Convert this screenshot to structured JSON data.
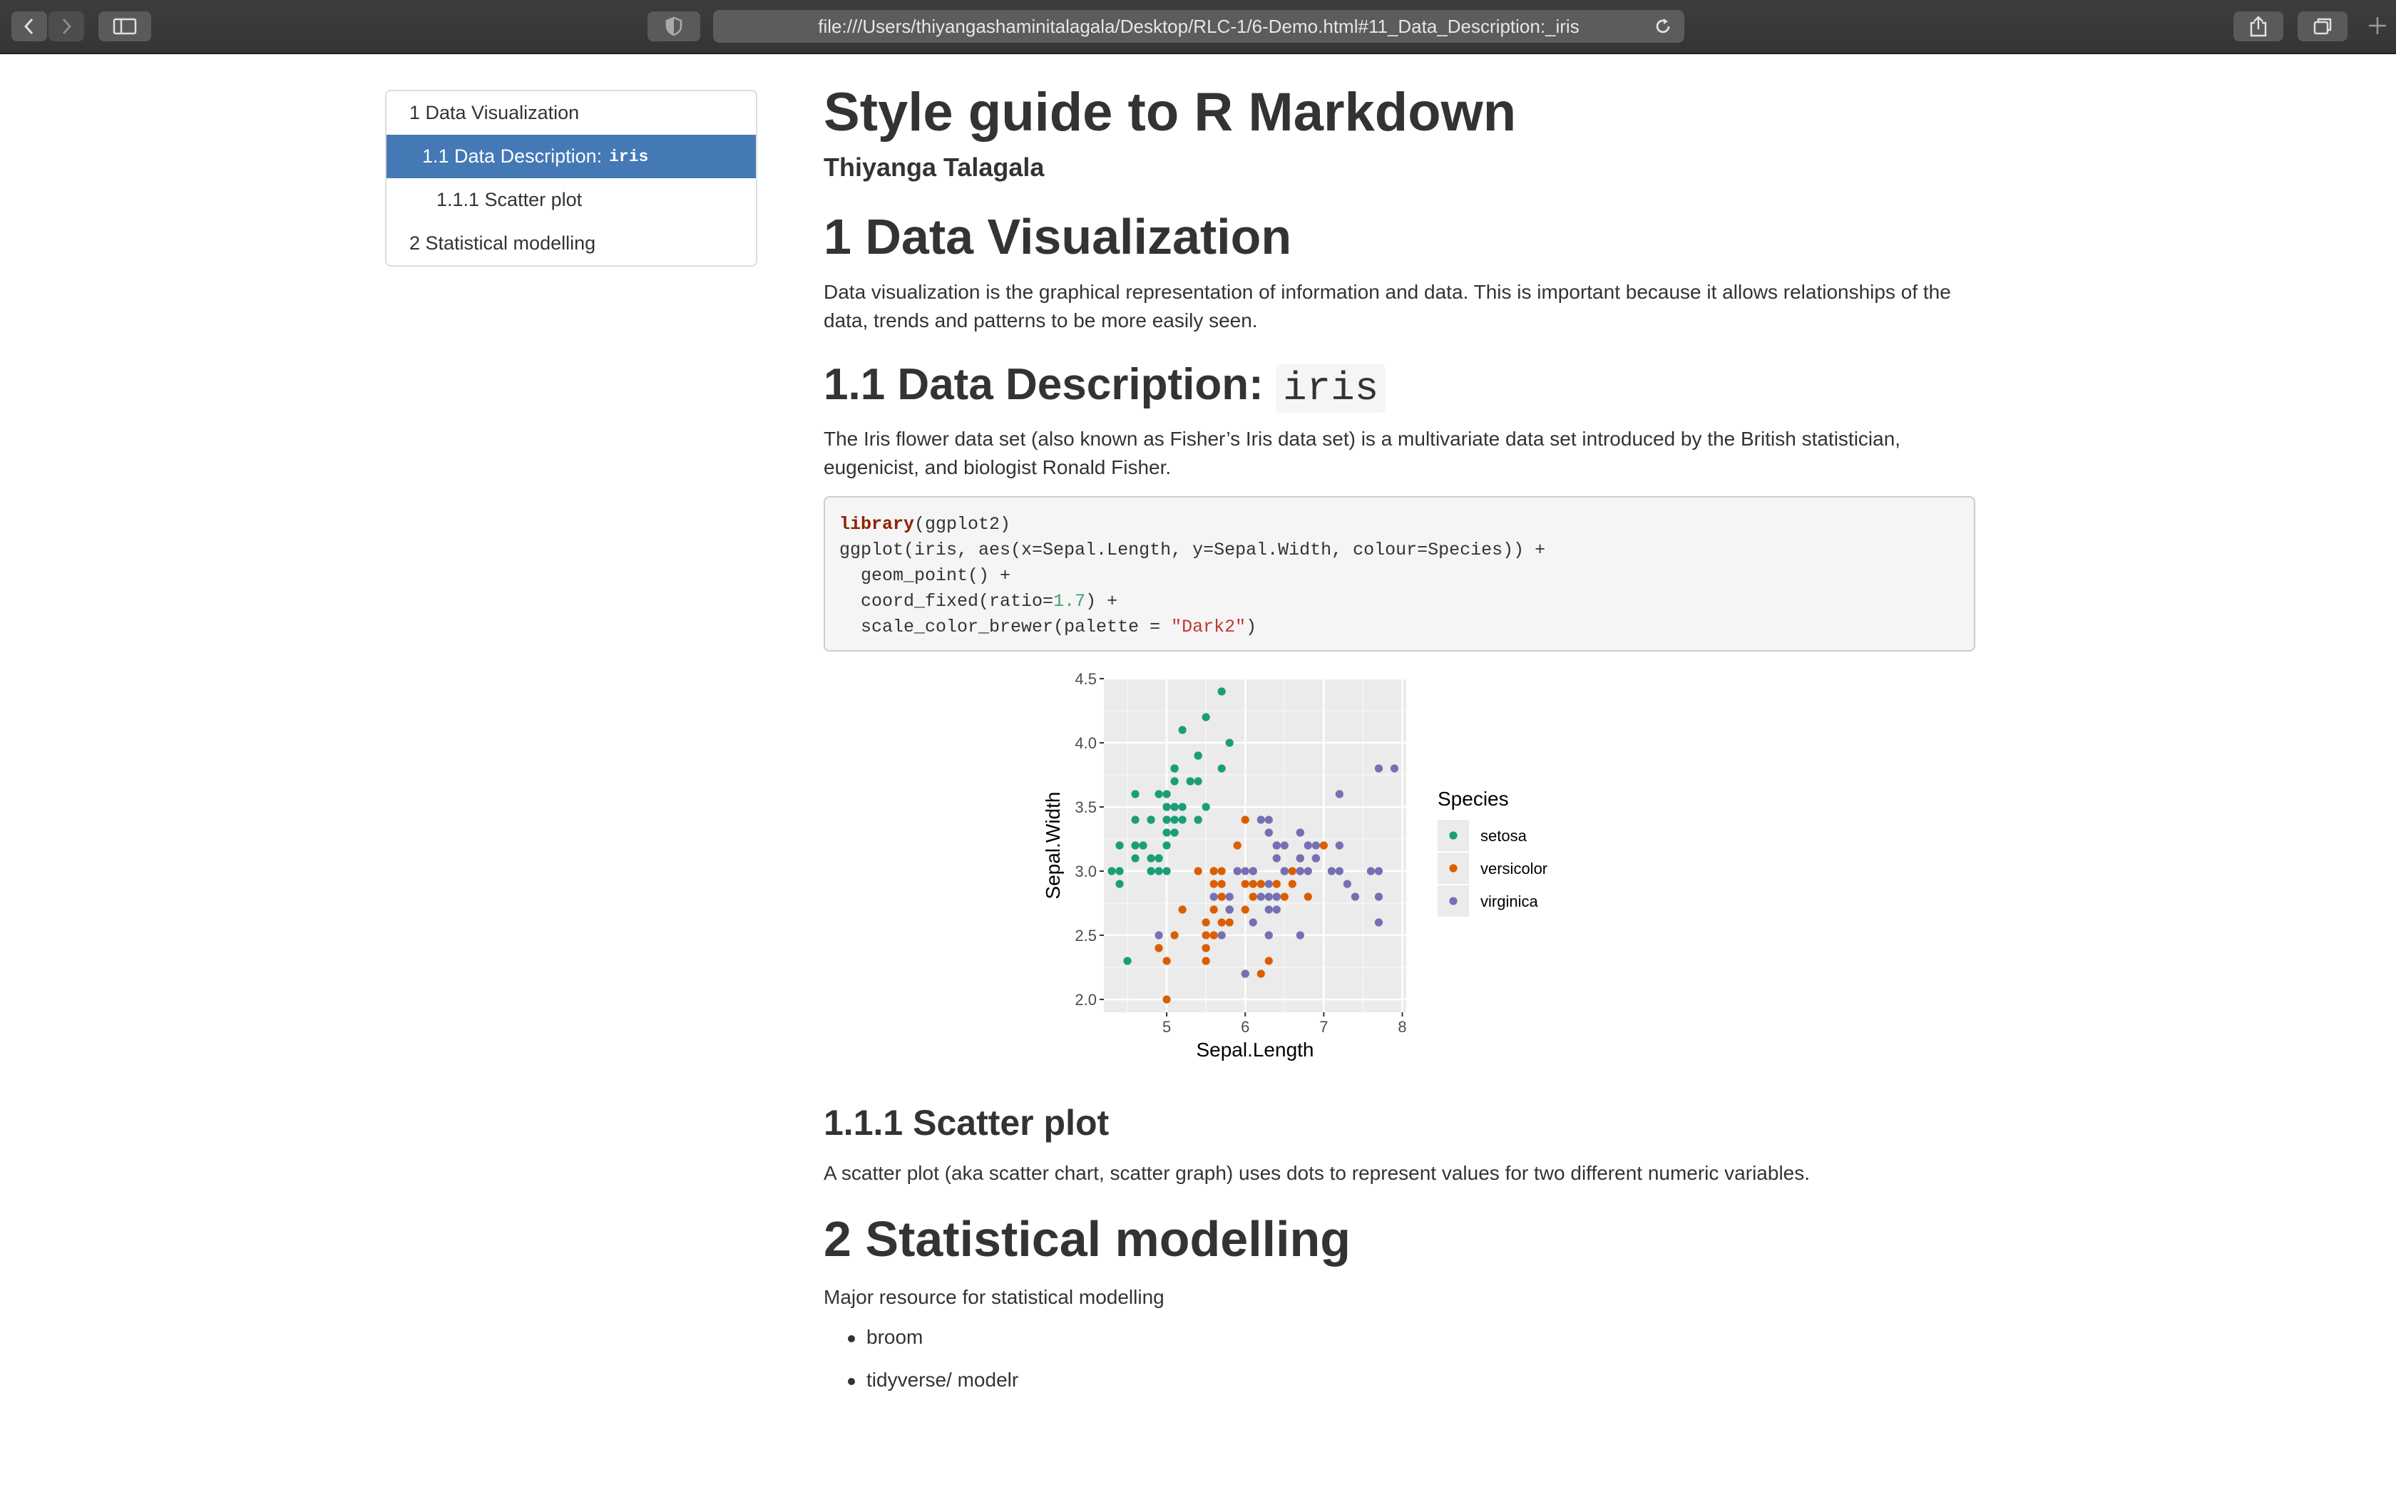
{
  "browser": {
    "url": "file:///Users/thiyangashaminitalagala/Desktop/RLC-1/6-Demo.html#11_Data_Description:_iris"
  },
  "toc": {
    "items": [
      {
        "label": "1 Data Visualization",
        "code": ""
      },
      {
        "label": "1.1 Data Description:",
        "code": "iris"
      },
      {
        "label": "1.1.1 Scatter plot",
        "code": ""
      },
      {
        "label": "2 Statistical modelling",
        "code": ""
      }
    ]
  },
  "doc": {
    "title": "Style guide to R Markdown",
    "author": "Thiyanga Talagala",
    "s1": {
      "heading": "1 Data Visualization",
      "text": "Data visualization is the graphical representation of information and data. This is important because it allows relationships of the data, trends and patterns to be more easily seen."
    },
    "s11": {
      "heading": "1.1 Data Description:",
      "code": "iris",
      "text": "The Iris flower data set (also known as Fisher’s Iris data set) is a multivariate data set introduced by the British statistician, eugenicist, and biologist Ronald Fisher."
    },
    "codeblock": {
      "l1_kw": "library",
      "l1_rest": "(ggplot2)",
      "l2": "ggplot(iris, aes(x=Sepal.Length, y=Sepal.Width, colour=Species)) +",
      "l3": "  geom_point() +",
      "l4_a": "  coord_fixed(ratio=",
      "l4_num": "1.7",
      "l4_b": ") +",
      "l5_a": "  scale_color_brewer(palette = ",
      "l5_str": "\"Dark2\"",
      "l5_b": ")"
    },
    "s111": {
      "heading": "1.1.1 Scatter plot",
      "text": "A scatter plot (aka scatter chart, scatter graph) uses dots to represent values for two different numeric variables."
    },
    "s2": {
      "heading": "2 Statistical modelling",
      "text": "Major resource for statistical modelling",
      "bullets": [
        "broom",
        "tidyverse/ modelr"
      ]
    }
  },
  "chart_data": {
    "type": "scatter",
    "xlabel": "Sepal.Length",
    "ylabel": "Sepal.Width",
    "xlim": [
      4.2,
      8.05
    ],
    "ylim": [
      1.9,
      4.5
    ],
    "xticks": [
      5,
      6,
      7,
      8
    ],
    "yticks": [
      "2.0",
      "2.5",
      "3.0",
      "3.5",
      "4.0",
      "4.5"
    ],
    "grid": true,
    "legend": {
      "title": "Species",
      "position": "right"
    },
    "series": [
      {
        "name": "setosa",
        "color": "#1b9e77",
        "points": [
          [
            5.1,
            3.5
          ],
          [
            4.9,
            3.0
          ],
          [
            4.7,
            3.2
          ],
          [
            4.6,
            3.1
          ],
          [
            5.0,
            3.6
          ],
          [
            5.4,
            3.9
          ],
          [
            4.6,
            3.4
          ],
          [
            5.0,
            3.4
          ],
          [
            4.4,
            2.9
          ],
          [
            4.9,
            3.1
          ],
          [
            5.4,
            3.7
          ],
          [
            4.8,
            3.4
          ],
          [
            4.8,
            3.0
          ],
          [
            4.3,
            3.0
          ],
          [
            5.8,
            4.0
          ],
          [
            5.7,
            4.4
          ],
          [
            5.4,
            3.9
          ],
          [
            5.1,
            3.5
          ],
          [
            5.7,
            3.8
          ],
          [
            5.1,
            3.8
          ],
          [
            5.4,
            3.4
          ],
          [
            5.1,
            3.7
          ],
          [
            4.6,
            3.6
          ],
          [
            5.1,
            3.3
          ],
          [
            4.8,
            3.4
          ],
          [
            5.0,
            3.0
          ],
          [
            5.0,
            3.4
          ],
          [
            5.2,
            3.5
          ],
          [
            5.2,
            3.4
          ],
          [
            4.7,
            3.2
          ],
          [
            4.8,
            3.1
          ],
          [
            5.4,
            3.4
          ],
          [
            5.2,
            4.1
          ],
          [
            5.5,
            4.2
          ],
          [
            4.9,
            3.1
          ],
          [
            5.0,
            3.2
          ],
          [
            5.5,
            3.5
          ],
          [
            4.9,
            3.6
          ],
          [
            4.4,
            3.0
          ],
          [
            5.1,
            3.4
          ],
          [
            5.0,
            3.5
          ],
          [
            4.5,
            2.3
          ],
          [
            4.4,
            3.2
          ],
          [
            5.0,
            3.5
          ],
          [
            5.1,
            3.8
          ],
          [
            4.8,
            3.0
          ],
          [
            5.1,
            3.8
          ],
          [
            4.6,
            3.2
          ],
          [
            5.3,
            3.7
          ],
          [
            5.0,
            3.3
          ]
        ]
      },
      {
        "name": "versicolor",
        "color": "#d95f02",
        "points": [
          [
            7.0,
            3.2
          ],
          [
            6.4,
            3.2
          ],
          [
            6.9,
            3.1
          ],
          [
            5.5,
            2.3
          ],
          [
            6.5,
            2.8
          ],
          [
            5.7,
            2.8
          ],
          [
            6.3,
            3.3
          ],
          [
            4.9,
            2.4
          ],
          [
            6.6,
            2.9
          ],
          [
            5.2,
            2.7
          ],
          [
            5.0,
            2.0
          ],
          [
            5.9,
            3.0
          ],
          [
            6.0,
            2.2
          ],
          [
            6.1,
            2.9
          ],
          [
            5.6,
            2.9
          ],
          [
            6.7,
            3.1
          ],
          [
            5.6,
            3.0
          ],
          [
            5.8,
            2.7
          ],
          [
            6.2,
            2.2
          ],
          [
            5.6,
            2.5
          ],
          [
            5.9,
            3.2
          ],
          [
            6.1,
            2.8
          ],
          [
            6.3,
            2.5
          ],
          [
            6.1,
            2.8
          ],
          [
            6.4,
            2.9
          ],
          [
            6.6,
            3.0
          ],
          [
            6.8,
            2.8
          ],
          [
            6.7,
            3.0
          ],
          [
            6.0,
            2.9
          ],
          [
            5.7,
            2.6
          ],
          [
            5.5,
            2.4
          ],
          [
            5.5,
            2.4
          ],
          [
            5.8,
            2.7
          ],
          [
            6.0,
            2.7
          ],
          [
            5.4,
            3.0
          ],
          [
            6.0,
            3.4
          ],
          [
            6.7,
            3.1
          ],
          [
            6.3,
            2.3
          ],
          [
            5.6,
            3.0
          ],
          [
            5.5,
            2.5
          ],
          [
            5.5,
            2.6
          ],
          [
            6.1,
            3.0
          ],
          [
            5.8,
            2.6
          ],
          [
            5.0,
            2.3
          ],
          [
            5.6,
            2.7
          ],
          [
            5.7,
            3.0
          ],
          [
            5.7,
            2.9
          ],
          [
            6.2,
            2.9
          ],
          [
            5.1,
            2.5
          ],
          [
            5.7,
            2.8
          ]
        ]
      },
      {
        "name": "virginica",
        "color": "#7570b3",
        "points": [
          [
            6.3,
            3.3
          ],
          [
            5.8,
            2.7
          ],
          [
            7.1,
            3.0
          ],
          [
            6.3,
            2.9
          ],
          [
            6.5,
            3.0
          ],
          [
            7.6,
            3.0
          ],
          [
            4.9,
            2.5
          ],
          [
            7.3,
            2.9
          ],
          [
            6.7,
            2.5
          ],
          [
            7.2,
            3.6
          ],
          [
            6.5,
            3.2
          ],
          [
            6.4,
            2.7
          ],
          [
            6.8,
            3.0
          ],
          [
            5.7,
            2.5
          ],
          [
            5.8,
            2.8
          ],
          [
            6.4,
            3.2
          ],
          [
            6.5,
            3.0
          ],
          [
            7.7,
            3.8
          ],
          [
            7.7,
            2.6
          ],
          [
            6.0,
            2.2
          ],
          [
            6.9,
            3.2
          ],
          [
            5.6,
            2.8
          ],
          [
            7.7,
            2.8
          ],
          [
            6.3,
            2.7
          ],
          [
            6.7,
            3.3
          ],
          [
            7.2,
            3.2
          ],
          [
            6.2,
            2.8
          ],
          [
            6.1,
            3.0
          ],
          [
            6.4,
            2.8
          ],
          [
            7.2,
            3.0
          ],
          [
            7.4,
            2.8
          ],
          [
            7.9,
            3.8
          ],
          [
            6.4,
            2.8
          ],
          [
            6.3,
            2.8
          ],
          [
            6.1,
            2.6
          ],
          [
            7.7,
            3.0
          ],
          [
            6.3,
            3.4
          ],
          [
            6.4,
            3.1
          ],
          [
            6.0,
            3.0
          ],
          [
            6.9,
            3.1
          ],
          [
            6.7,
            3.1
          ],
          [
            6.9,
            3.1
          ],
          [
            5.8,
            2.7
          ],
          [
            6.8,
            3.2
          ],
          [
            6.7,
            3.3
          ],
          [
            6.7,
            3.0
          ],
          [
            6.3,
            2.5
          ],
          [
            6.5,
            3.0
          ],
          [
            6.2,
            3.4
          ],
          [
            5.9,
            3.0
          ]
        ]
      }
    ]
  }
}
